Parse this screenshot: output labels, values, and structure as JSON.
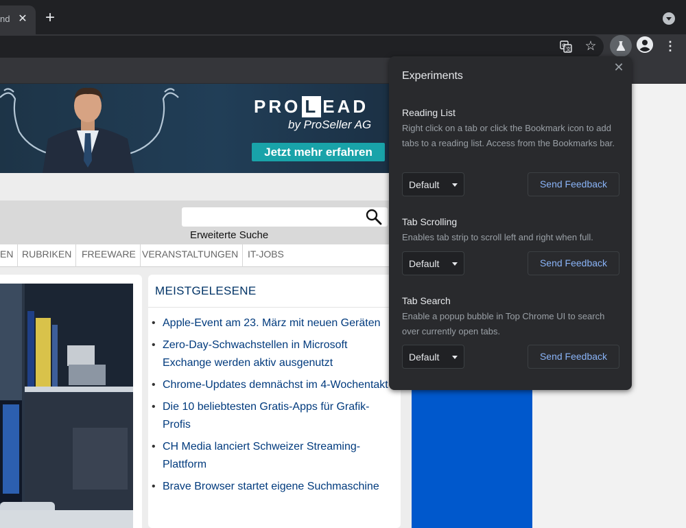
{
  "browser": {
    "tab_title": "nd",
    "tab_close": "✕",
    "new_tab": "+",
    "star": "☆",
    "menu": "⋮",
    "icons": [
      "tab-search-icon",
      "translate-icon",
      "star-icon",
      "labs-icon",
      "profile-icon",
      "menu-icon"
    ]
  },
  "page": {
    "banner": {
      "brand_pre": "PRO",
      "brand_l": "L",
      "brand_post": "EAD",
      "subtitle": "by ProSeller AG",
      "cta": "Jetzt mehr erfahren"
    },
    "search": {
      "placeholder": "",
      "advanced_link": "Erweiterte Suche"
    },
    "nav": [
      "EN",
      "RUBRIKEN",
      "FREEWARE",
      "VERANSTALTUNGEN",
      "IT-JOBS"
    ],
    "most_read": {
      "title": "MEISTGELESENE",
      "items": [
        "Apple-Event am 23. März mit neuen Geräten",
        "Zero-Day-Schwachstellen in Microsoft Exchange werden aktiv ausgenutzt",
        "Chrome-Updates demnächst im 4-Wochentakt",
        "Die 10 beliebtesten Gratis-Apps für Grafik-Profis",
        "CH Media lanciert Schweizer Streaming-Plattform",
        "Brave Browser startet eigene Suchmaschine"
      ]
    }
  },
  "experiments": {
    "title": "Experiments",
    "close": "✕",
    "features": [
      {
        "title": "Reading List",
        "description": "Right click on a tab or click the Bookmark icon to add tabs to a reading list. Access from the Bookmarks bar.",
        "state": "Default",
        "feedback": "Send Feedback"
      },
      {
        "title": "Tab Scrolling",
        "description": "Enables tab strip to scroll left and right when full.",
        "state": "Default",
        "feedback": "Send Feedback"
      },
      {
        "title": "Tab Search",
        "description": "Enable a popup bubble in Top Chrome UI to search over currently open tabs.",
        "state": "Default",
        "feedback": "Send Feedback"
      }
    ]
  },
  "colors": {
    "chrome_dark": "#202124",
    "toolbar": "#35363a",
    "popup_bg": "#292a2d",
    "link_blue": "#8ab4f8",
    "news_link": "#003a7d",
    "cta_teal": "#19a3a9",
    "ad_blue": "#0058cc"
  }
}
